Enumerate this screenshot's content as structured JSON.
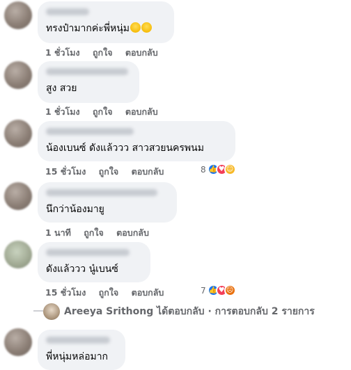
{
  "comments": [
    {
      "text": "ทรงป๋ามากค่ะพี่หนุ่ม",
      "time": "1 ชั่วโมง",
      "like": "ถูกใจ",
      "reply": "ตอบกลับ"
    },
    {
      "text": "สูง สวย",
      "time": "1 ชั่วโมง",
      "like": "ถูกใจ",
      "reply": "ตอบกลับ"
    },
    {
      "text": "น้องเบนซ์ ดังแล้ววว สาวสวยนครพนม",
      "time": "15 ชั่วโมง",
      "like": "ถูกใจ",
      "reply": "ตอบกลับ",
      "reaction_count": "8",
      "reactions": [
        "like-icon",
        "love-icon",
        "haha-icon"
      ]
    },
    {
      "text": "นึกว่าน้องมายู",
      "time": "1 นาที",
      "like": "ถูกใจ",
      "reply": "ตอบกลับ"
    },
    {
      "text": "ดังแล้ววว นู๋เบนซ์",
      "time": "15 ชั่วโมง",
      "like": "ถูกใจ",
      "reply": "ตอบกลับ",
      "reaction_count": "7",
      "reactions": [
        "like-icon",
        "love-icon",
        "angry-icon"
      ]
    },
    {
      "text": "พี่หนุ่มหล่อมาก"
    }
  ],
  "reply_summary": {
    "name": "Areeya Srithong",
    "action": "ได้ตอบกลับ",
    "separator": "·",
    "replies": "การตอบกลับ 2 รายการ"
  },
  "colors": {
    "bubble": "#f0f2f5",
    "meta": "#65676b",
    "like": "#1877f2",
    "love": "#f33e58",
    "haha": "#f7b928",
    "angry": "#e9710f"
  }
}
